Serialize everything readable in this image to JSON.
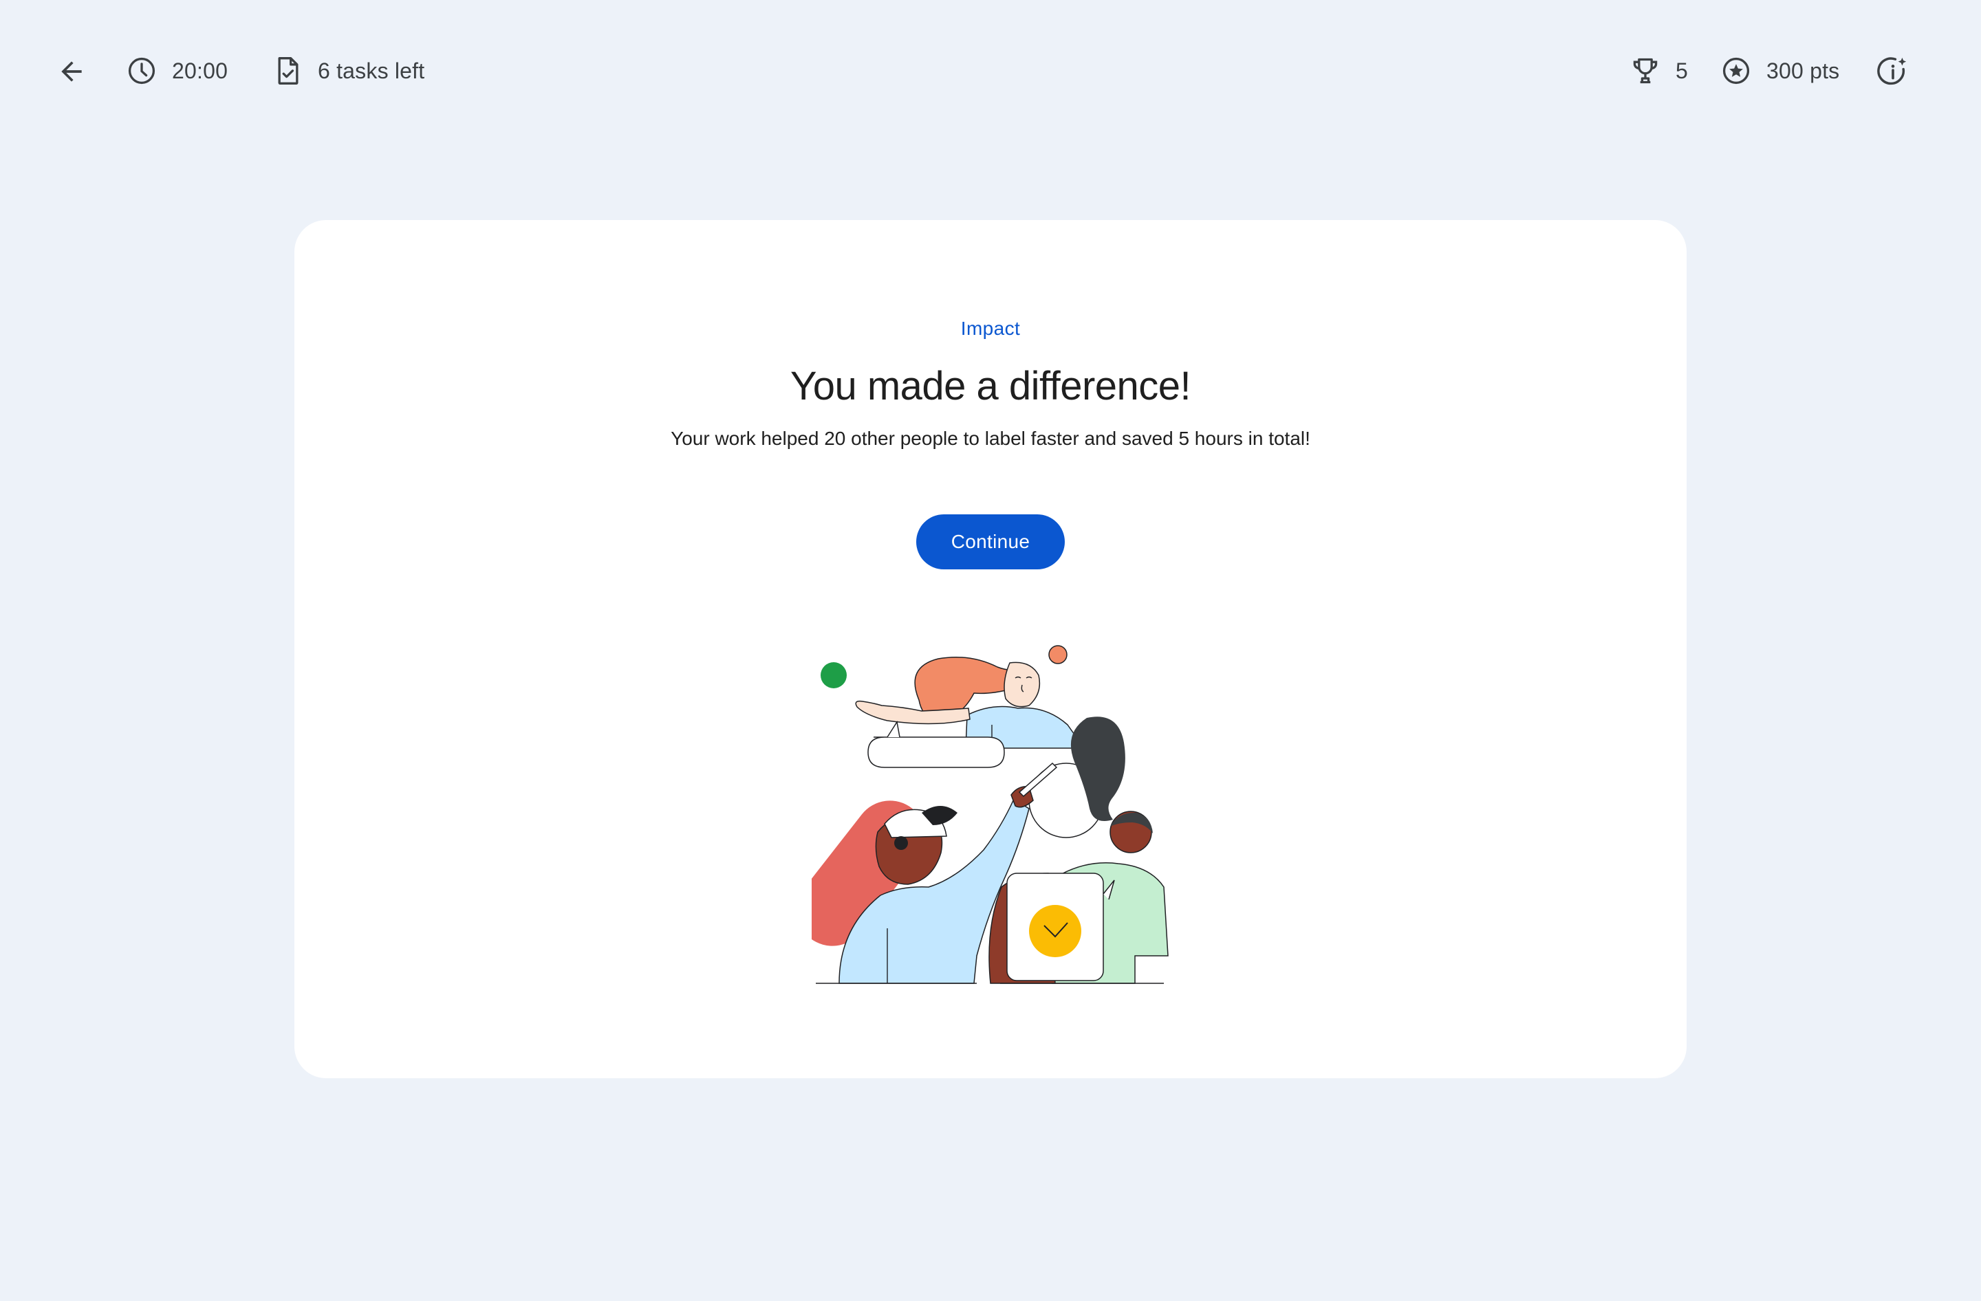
{
  "header": {
    "timer": "20:00",
    "tasks_left": "6 tasks left",
    "trophies": "5",
    "points": "300 pts"
  },
  "icons": {
    "back": "arrow-back-icon",
    "timer": "clock-icon",
    "tasks": "task-document-icon",
    "trophy": "trophy-icon",
    "points": "star-circle-icon",
    "info": "info-sparkle-icon"
  },
  "card": {
    "eyebrow": "Impact",
    "title": "You made a difference!",
    "body": "Your work helped 20 other people to label faster and saved 5 hours in total!",
    "continue_label": "Continue"
  },
  "colors": {
    "page_background": "#edf2f9",
    "card_background": "#ffffff",
    "accent": "#0b57d0",
    "text_primary": "#1f1f1f",
    "text_secondary": "#3c4043"
  }
}
